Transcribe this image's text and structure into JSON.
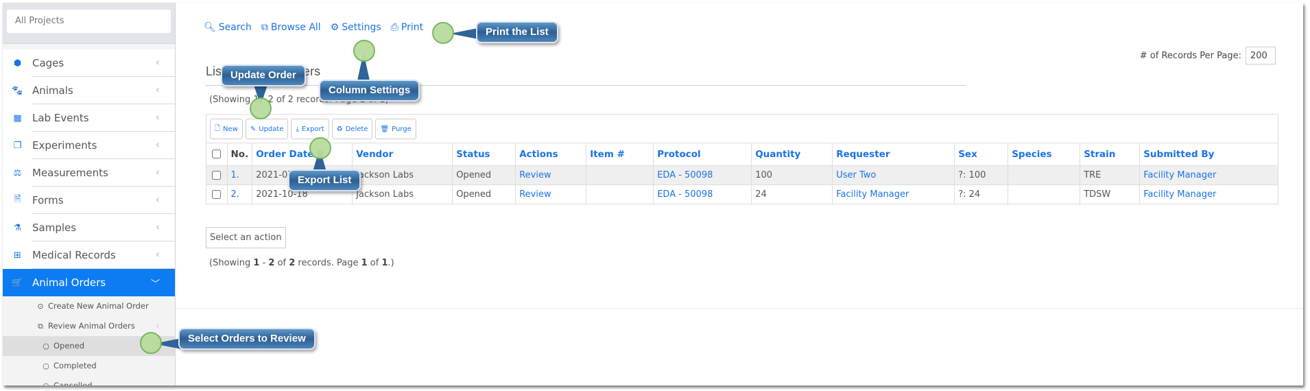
{
  "sidebar": {
    "project_selector": "All Projects",
    "items": [
      {
        "label": "Cages",
        "icon": "cube-icon"
      },
      {
        "label": "Animals",
        "icon": "paw-icon"
      },
      {
        "label": "Lab Events",
        "icon": "calendar-icon"
      },
      {
        "label": "Experiments",
        "icon": "copy-icon"
      },
      {
        "label": "Measurements",
        "icon": "balance-scale-icon"
      },
      {
        "label": "Forms",
        "icon": "file-text-icon"
      },
      {
        "label": "Samples",
        "icon": "flask-icon"
      },
      {
        "label": "Medical Records",
        "icon": "medkit-icon"
      },
      {
        "label": "Animal Orders",
        "icon": "cart-icon",
        "active": true
      }
    ],
    "subitems": [
      {
        "label": "Create New Animal Order",
        "icon": "dot-circle-icon"
      },
      {
        "label": "Review Animal Orders",
        "icon": "clone-icon"
      },
      {
        "label": "Opened",
        "icon": "circle-icon",
        "selected": true
      },
      {
        "label": "Completed",
        "icon": "circle-icon"
      },
      {
        "label": "Cancelled",
        "icon": "circle-icon"
      }
    ],
    "accent_color": "#0d7cf2"
  },
  "toolbar": {
    "search": "Search",
    "browse_all": "Browse All",
    "settings": "Settings",
    "print": "Print"
  },
  "records_per_page": {
    "label": "# of Records Per Page:",
    "value": "200"
  },
  "page_title": "List of Animal Orders",
  "showing_top": "(Showing 1 - 2 of 2 records. Page 1 of 1)",
  "actions": {
    "new": "New",
    "update": "Update",
    "export": "Export",
    "delete": "Delete",
    "purge": "Purge"
  },
  "table": {
    "columns": [
      "No.",
      "Order Date",
      "Vendor",
      "Status",
      "Actions",
      "Item #",
      "Protocol",
      "Quantity",
      "Requester",
      "Sex",
      "Species",
      "Strain",
      "Submitted By"
    ],
    "sort_indicator": "▼",
    "rows": [
      {
        "no": "1.",
        "order_date": "2021-07-15",
        "vendor": "Jackson Labs",
        "status": "Opened",
        "action": "Review",
        "item": "",
        "protocol": "EDA - 50098",
        "quantity": "100",
        "requester": "User Two",
        "sex": "?: 100",
        "species": "",
        "strain": "TRE",
        "submitted_by": "Facility Manager"
      },
      {
        "no": "2.",
        "order_date": "2021-10-18",
        "vendor": "Jackson Labs",
        "status": "Opened",
        "action": "Review",
        "item": "",
        "protocol": "EDA - 50098",
        "quantity": "24",
        "requester": "Facility Manager",
        "sex": "?: 24",
        "species": "",
        "strain": "TDSW",
        "submitted_by": "Facility Manager"
      }
    ]
  },
  "select_action": "Select an action",
  "showing_bottom": {
    "prefix": "(Showing ",
    "from": "1",
    "sep1": " - ",
    "to": "2",
    "sep2": " of ",
    "total": "2",
    "sep3": " records. Page ",
    "page": "1",
    "sep4": " of ",
    "pages": "1",
    "suffix": ".)"
  },
  "callouts": {
    "print": "Print the List",
    "column_settings": "Column Settings",
    "update_order": "Update Order",
    "export_list": "Export List",
    "select_orders": "Select Orders to Review"
  }
}
